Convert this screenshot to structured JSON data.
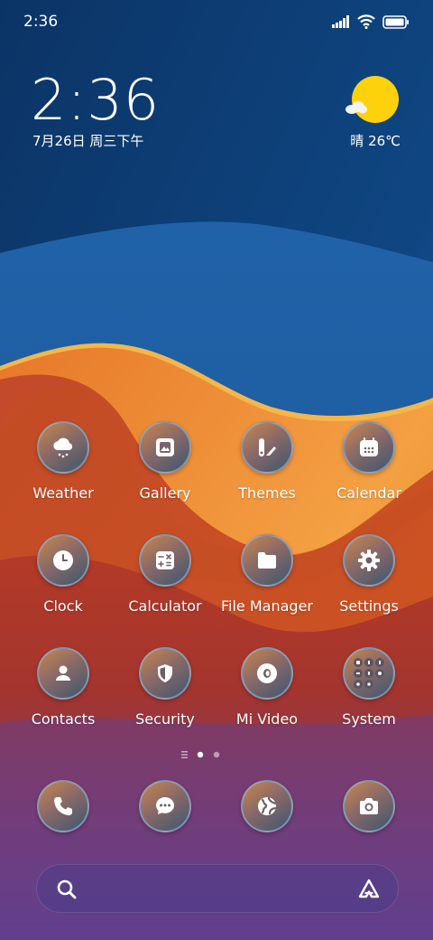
{
  "status_bar": {
    "time": "2:36",
    "icons": [
      "signal-icon",
      "wifi-icon",
      "battery-icon"
    ]
  },
  "lockclock": {
    "time": "2:36",
    "date": "7月26日 周三下午"
  },
  "weather": {
    "icon": "sunny-cloudy-icon",
    "text": "晴 26℃"
  },
  "apps": [
    {
      "label": "Weather",
      "icon": "weather-icon"
    },
    {
      "label": "Gallery",
      "icon": "gallery-icon"
    },
    {
      "label": "Themes",
      "icon": "themes-icon"
    },
    {
      "label": "Calendar",
      "icon": "calendar-icon"
    },
    {
      "label": "Clock",
      "icon": "clock-icon"
    },
    {
      "label": "Calculator",
      "icon": "calculator-icon"
    },
    {
      "label": "File Manager",
      "icon": "folder-icon"
    },
    {
      "label": "Settings",
      "icon": "gear-icon"
    },
    {
      "label": "Contacts",
      "icon": "contact-icon"
    },
    {
      "label": "Security",
      "icon": "shield-icon"
    },
    {
      "label": "Mi Video",
      "icon": "video-icon"
    },
    {
      "label": "System",
      "icon": "folder-grid-icon"
    }
  ],
  "page_indicator": {
    "pages": 2,
    "current": 1
  },
  "dock": [
    "phone-icon",
    "messages-icon",
    "browser-icon",
    "camera-icon"
  ],
  "search": {
    "search_icon": "search-icon",
    "assistant_icon": "assistant-icon"
  },
  "colors": {
    "sky_top": "#0c3569",
    "blue_wave": "#1d5fa3",
    "orange": "#f0902f",
    "red": "#c24a2a",
    "purple": "#5b3f8f"
  }
}
